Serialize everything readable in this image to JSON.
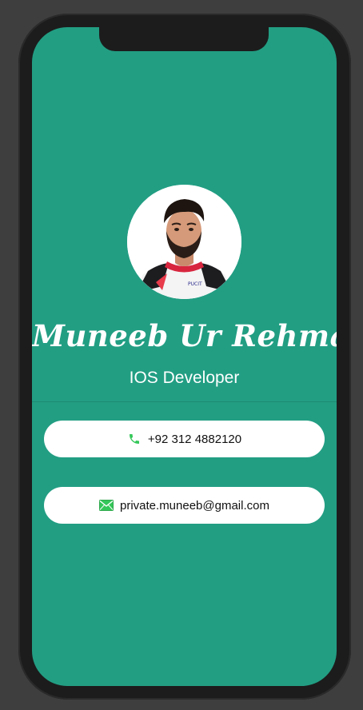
{
  "profile": {
    "name": "Muneeb Ur Rehman",
    "title": "IOS Developer",
    "avatar_alt": "profile-photo"
  },
  "contacts": {
    "phone": "+92 312 4882120",
    "email": "private.muneeb@gmail.com"
  },
  "icons": {
    "phone": "phone-icon",
    "email": "envelope-icon"
  },
  "colors": {
    "screen_background": "#229e83",
    "card_background": "#ffffff",
    "phone_icon": "#34c759",
    "email_icon": "#34c759",
    "frame": "#1c1c1c"
  }
}
